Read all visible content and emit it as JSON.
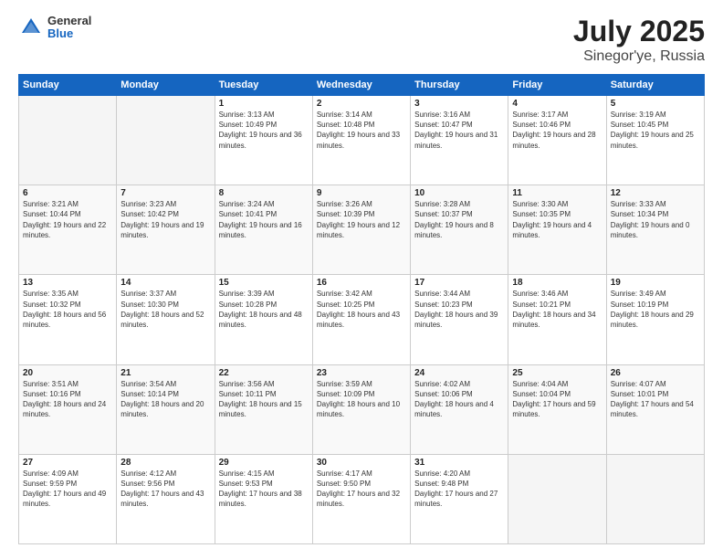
{
  "header": {
    "logo": {
      "general": "General",
      "blue": "Blue"
    },
    "month": "July 2025",
    "location": "Sinegor'ye, Russia"
  },
  "weekdays": [
    "Sunday",
    "Monday",
    "Tuesday",
    "Wednesday",
    "Thursday",
    "Friday",
    "Saturday"
  ],
  "weeks": [
    [
      {
        "day": "",
        "empty": true
      },
      {
        "day": "",
        "empty": true
      },
      {
        "day": "1",
        "sunrise": "3:13 AM",
        "sunset": "10:49 PM",
        "daylight": "19 hours and 36 minutes."
      },
      {
        "day": "2",
        "sunrise": "3:14 AM",
        "sunset": "10:48 PM",
        "daylight": "19 hours and 33 minutes."
      },
      {
        "day": "3",
        "sunrise": "3:16 AM",
        "sunset": "10:47 PM",
        "daylight": "19 hours and 31 minutes."
      },
      {
        "day": "4",
        "sunrise": "3:17 AM",
        "sunset": "10:46 PM",
        "daylight": "19 hours and 28 minutes."
      },
      {
        "day": "5",
        "sunrise": "3:19 AM",
        "sunset": "10:45 PM",
        "daylight": "19 hours and 25 minutes."
      }
    ],
    [
      {
        "day": "6",
        "sunrise": "3:21 AM",
        "sunset": "10:44 PM",
        "daylight": "19 hours and 22 minutes."
      },
      {
        "day": "7",
        "sunrise": "3:23 AM",
        "sunset": "10:42 PM",
        "daylight": "19 hours and 19 minutes."
      },
      {
        "day": "8",
        "sunrise": "3:24 AM",
        "sunset": "10:41 PM",
        "daylight": "19 hours and 16 minutes."
      },
      {
        "day": "9",
        "sunrise": "3:26 AM",
        "sunset": "10:39 PM",
        "daylight": "19 hours and 12 minutes."
      },
      {
        "day": "10",
        "sunrise": "3:28 AM",
        "sunset": "10:37 PM",
        "daylight": "19 hours and 8 minutes."
      },
      {
        "day": "11",
        "sunrise": "3:30 AM",
        "sunset": "10:35 PM",
        "daylight": "19 hours and 4 minutes."
      },
      {
        "day": "12",
        "sunrise": "3:33 AM",
        "sunset": "10:34 PM",
        "daylight": "19 hours and 0 minutes."
      }
    ],
    [
      {
        "day": "13",
        "sunrise": "3:35 AM",
        "sunset": "10:32 PM",
        "daylight": "18 hours and 56 minutes."
      },
      {
        "day": "14",
        "sunrise": "3:37 AM",
        "sunset": "10:30 PM",
        "daylight": "18 hours and 52 minutes."
      },
      {
        "day": "15",
        "sunrise": "3:39 AM",
        "sunset": "10:28 PM",
        "daylight": "18 hours and 48 minutes."
      },
      {
        "day": "16",
        "sunrise": "3:42 AM",
        "sunset": "10:25 PM",
        "daylight": "18 hours and 43 minutes."
      },
      {
        "day": "17",
        "sunrise": "3:44 AM",
        "sunset": "10:23 PM",
        "daylight": "18 hours and 39 minutes."
      },
      {
        "day": "18",
        "sunrise": "3:46 AM",
        "sunset": "10:21 PM",
        "daylight": "18 hours and 34 minutes."
      },
      {
        "day": "19",
        "sunrise": "3:49 AM",
        "sunset": "10:19 PM",
        "daylight": "18 hours and 29 minutes."
      }
    ],
    [
      {
        "day": "20",
        "sunrise": "3:51 AM",
        "sunset": "10:16 PM",
        "daylight": "18 hours and 24 minutes."
      },
      {
        "day": "21",
        "sunrise": "3:54 AM",
        "sunset": "10:14 PM",
        "daylight": "18 hours and 20 minutes."
      },
      {
        "day": "22",
        "sunrise": "3:56 AM",
        "sunset": "10:11 PM",
        "daylight": "18 hours and 15 minutes."
      },
      {
        "day": "23",
        "sunrise": "3:59 AM",
        "sunset": "10:09 PM",
        "daylight": "18 hours and 10 minutes."
      },
      {
        "day": "24",
        "sunrise": "4:02 AM",
        "sunset": "10:06 PM",
        "daylight": "18 hours and 4 minutes."
      },
      {
        "day": "25",
        "sunrise": "4:04 AM",
        "sunset": "10:04 PM",
        "daylight": "17 hours and 59 minutes."
      },
      {
        "day": "26",
        "sunrise": "4:07 AM",
        "sunset": "10:01 PM",
        "daylight": "17 hours and 54 minutes."
      }
    ],
    [
      {
        "day": "27",
        "sunrise": "4:09 AM",
        "sunset": "9:59 PM",
        "daylight": "17 hours and 49 minutes."
      },
      {
        "day": "28",
        "sunrise": "4:12 AM",
        "sunset": "9:56 PM",
        "daylight": "17 hours and 43 minutes."
      },
      {
        "day": "29",
        "sunrise": "4:15 AM",
        "sunset": "9:53 PM",
        "daylight": "17 hours and 38 minutes."
      },
      {
        "day": "30",
        "sunrise": "4:17 AM",
        "sunset": "9:50 PM",
        "daylight": "17 hours and 32 minutes."
      },
      {
        "day": "31",
        "sunrise": "4:20 AM",
        "sunset": "9:48 PM",
        "daylight": "17 hours and 27 minutes."
      },
      {
        "day": "",
        "empty": true
      },
      {
        "day": "",
        "empty": true
      }
    ]
  ]
}
